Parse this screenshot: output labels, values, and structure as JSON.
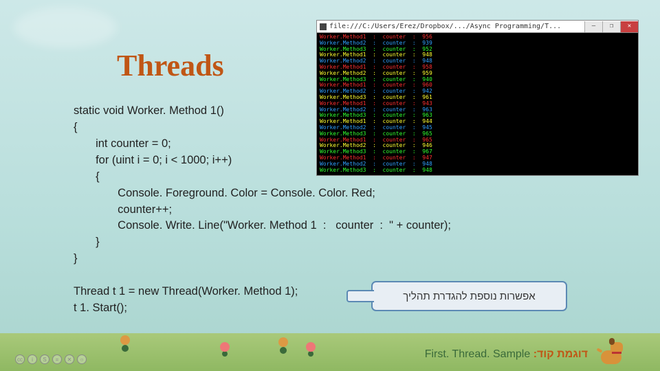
{
  "title": "Threads",
  "code_lines": [
    "static void Worker. Method 1()",
    "{",
    "       int counter = 0;",
    "       for (uint i = 0; i < 1000; i++)",
    "       {",
    "              Console. Foreground. Color = Console. Color. Red;",
    "              counter++;",
    "              Console. Write. Line(\"Worker. Method 1  :   counter  :  \" + counter);",
    "       }",
    "}",
    "",
    "Thread t 1 = new Thread(Worker. Method 1);",
    "t 1. Start();"
  ],
  "callout_text": "אפשרות נוספת להגדרת תהליך",
  "footer": {
    "hebrew": "דוגמת קוד:",
    "latin": "First. Thread. Sample"
  },
  "console": {
    "title": "file:///C:/Users/Erez/Dropbox/.../Async Programming/T...",
    "buttons": {
      "min": "–",
      "max": "❐",
      "close": "✕"
    },
    "entries": [
      {
        "m": 1,
        "c": 956,
        "color": "#ff3030"
      },
      {
        "m": 2,
        "c": 939,
        "color": "#30a0ff"
      },
      {
        "m": 3,
        "c": 952,
        "color": "#30ff30"
      },
      {
        "m": 1,
        "c": 948,
        "color": "#ffff30"
      },
      {
        "m": 2,
        "c": 948,
        "color": "#30a0ff"
      },
      {
        "m": 1,
        "c": 958,
        "color": "#ff3030"
      },
      {
        "m": 2,
        "c": 959,
        "color": "#ffff30"
      },
      {
        "m": 3,
        "c": 940,
        "color": "#30ff30"
      },
      {
        "m": 1,
        "c": 960,
        "color": "#ff3030"
      },
      {
        "m": 2,
        "c": 942,
        "color": "#30a0ff"
      },
      {
        "m": 3,
        "c": 961,
        "color": "#ffff30"
      },
      {
        "m": 1,
        "c": 943,
        "color": "#ff3030"
      },
      {
        "m": 2,
        "c": 963,
        "color": "#30a0ff"
      },
      {
        "m": 3,
        "c": 963,
        "color": "#30ff30"
      },
      {
        "m": 1,
        "c": 944,
        "color": "#ffff30"
      },
      {
        "m": 2,
        "c": 945,
        "color": "#30a0ff"
      },
      {
        "m": 3,
        "c": 965,
        "color": "#30ff30"
      },
      {
        "m": 1,
        "c": 965,
        "color": "#ff3030"
      },
      {
        "m": 2,
        "c": 946,
        "color": "#ffff30"
      },
      {
        "m": 3,
        "c": 967,
        "color": "#30ff30"
      },
      {
        "m": 1,
        "c": 947,
        "color": "#ff3030"
      },
      {
        "m": 2,
        "c": 948,
        "color": "#30a0ff"
      },
      {
        "m": 3,
        "c": 948,
        "color": "#30ff30"
      }
    ]
  },
  "cc_glyphs": [
    "cc",
    "i",
    "S",
    "=",
    "✕",
    "○"
  ]
}
